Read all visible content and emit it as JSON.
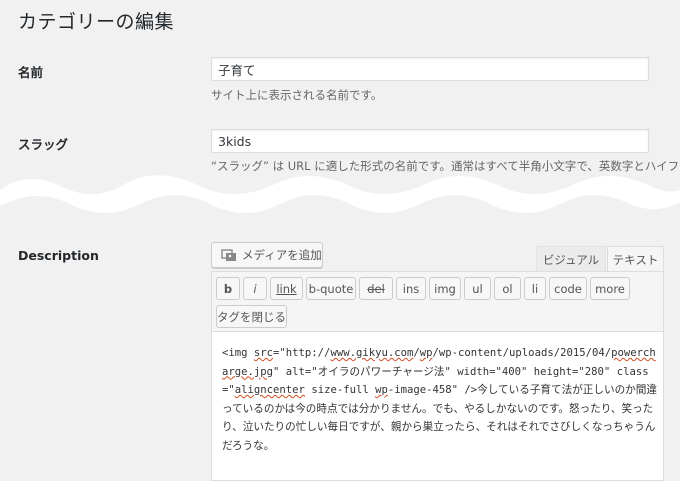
{
  "page": {
    "title": "カテゴリーの編集"
  },
  "name_field": {
    "label": "名前",
    "value": "子育て",
    "hint": "サイト上に表示される名前です。"
  },
  "slug_field": {
    "label": "スラッグ",
    "value": "3kids",
    "hint": "“スラッグ” は URL に適した形式の名前です。通常はすべて半角小文字で、英数字とハイフン"
  },
  "description": {
    "label": "Description",
    "media_button": "メディアを追加",
    "tabs": [
      "ビジュアル",
      "テキスト"
    ],
    "quicktags": [
      "b",
      "i",
      "link",
      "b-quote",
      "del",
      "ins",
      "img",
      "ul",
      "ol",
      "li",
      "code",
      "more",
      "タグを閉じる"
    ],
    "content": {
      "seg1": "<img ",
      "seg2": "src",
      "seg3": "=\"http://",
      "seg4": "www.gikyu.com",
      "seg5": "/",
      "seg6": "wp",
      "seg7": "/wp-content/uploads/2015/04/",
      "seg8": "powercharge.jpg",
      "seg9": "\" alt=\"オイラのパワーチャージ法\" width=\"400\" height=\"280\" class=\"",
      "seg10": "aligncenter",
      "seg11": " size-full ",
      "seg12": "wp",
      "seg13": "-image-458\" />今している子育て法が正しいのか間違っているのかは今の時点では分かりません。でも、やるしかないのです。怒ったり、笑ったり、泣いたりの忙しい毎日ですが、親から巣立ったら、それはそれでさびしくなっちゃうんだろうな。"
    }
  }
}
